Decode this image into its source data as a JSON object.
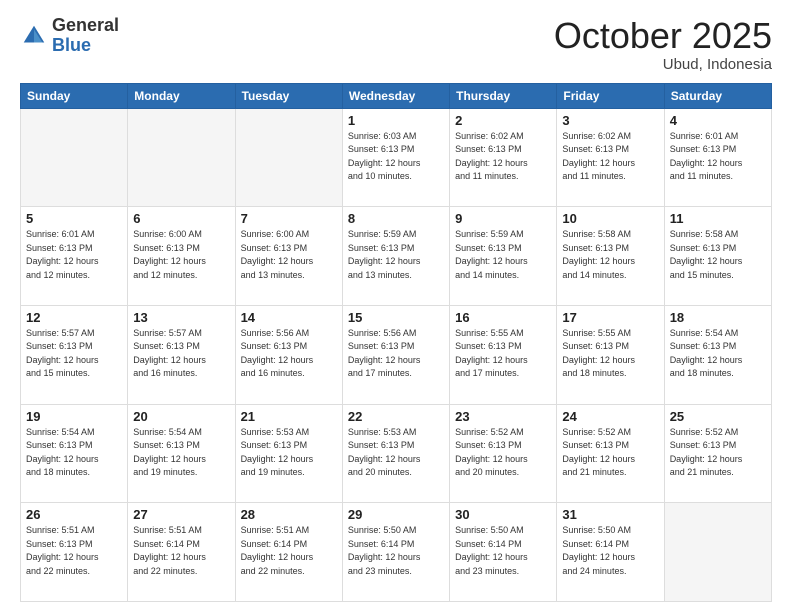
{
  "header": {
    "logo_general": "General",
    "logo_blue": "Blue",
    "month": "October 2025",
    "location": "Ubud, Indonesia"
  },
  "days_of_week": [
    "Sunday",
    "Monday",
    "Tuesday",
    "Wednesday",
    "Thursday",
    "Friday",
    "Saturday"
  ],
  "weeks": [
    {
      "days": [
        {
          "num": "",
          "info": ""
        },
        {
          "num": "",
          "info": ""
        },
        {
          "num": "",
          "info": ""
        },
        {
          "num": "1",
          "info": "Sunrise: 6:03 AM\nSunset: 6:13 PM\nDaylight: 12 hours\nand 10 minutes."
        },
        {
          "num": "2",
          "info": "Sunrise: 6:02 AM\nSunset: 6:13 PM\nDaylight: 12 hours\nand 11 minutes."
        },
        {
          "num": "3",
          "info": "Sunrise: 6:02 AM\nSunset: 6:13 PM\nDaylight: 12 hours\nand 11 minutes."
        },
        {
          "num": "4",
          "info": "Sunrise: 6:01 AM\nSunset: 6:13 PM\nDaylight: 12 hours\nand 11 minutes."
        }
      ]
    },
    {
      "days": [
        {
          "num": "5",
          "info": "Sunrise: 6:01 AM\nSunset: 6:13 PM\nDaylight: 12 hours\nand 12 minutes."
        },
        {
          "num": "6",
          "info": "Sunrise: 6:00 AM\nSunset: 6:13 PM\nDaylight: 12 hours\nand 12 minutes."
        },
        {
          "num": "7",
          "info": "Sunrise: 6:00 AM\nSunset: 6:13 PM\nDaylight: 12 hours\nand 13 minutes."
        },
        {
          "num": "8",
          "info": "Sunrise: 5:59 AM\nSunset: 6:13 PM\nDaylight: 12 hours\nand 13 minutes."
        },
        {
          "num": "9",
          "info": "Sunrise: 5:59 AM\nSunset: 6:13 PM\nDaylight: 12 hours\nand 14 minutes."
        },
        {
          "num": "10",
          "info": "Sunrise: 5:58 AM\nSunset: 6:13 PM\nDaylight: 12 hours\nand 14 minutes."
        },
        {
          "num": "11",
          "info": "Sunrise: 5:58 AM\nSunset: 6:13 PM\nDaylight: 12 hours\nand 15 minutes."
        }
      ]
    },
    {
      "days": [
        {
          "num": "12",
          "info": "Sunrise: 5:57 AM\nSunset: 6:13 PM\nDaylight: 12 hours\nand 15 minutes."
        },
        {
          "num": "13",
          "info": "Sunrise: 5:57 AM\nSunset: 6:13 PM\nDaylight: 12 hours\nand 16 minutes."
        },
        {
          "num": "14",
          "info": "Sunrise: 5:56 AM\nSunset: 6:13 PM\nDaylight: 12 hours\nand 16 minutes."
        },
        {
          "num": "15",
          "info": "Sunrise: 5:56 AM\nSunset: 6:13 PM\nDaylight: 12 hours\nand 17 minutes."
        },
        {
          "num": "16",
          "info": "Sunrise: 5:55 AM\nSunset: 6:13 PM\nDaylight: 12 hours\nand 17 minutes."
        },
        {
          "num": "17",
          "info": "Sunrise: 5:55 AM\nSunset: 6:13 PM\nDaylight: 12 hours\nand 18 minutes."
        },
        {
          "num": "18",
          "info": "Sunrise: 5:54 AM\nSunset: 6:13 PM\nDaylight: 12 hours\nand 18 minutes."
        }
      ]
    },
    {
      "days": [
        {
          "num": "19",
          "info": "Sunrise: 5:54 AM\nSunset: 6:13 PM\nDaylight: 12 hours\nand 18 minutes."
        },
        {
          "num": "20",
          "info": "Sunrise: 5:54 AM\nSunset: 6:13 PM\nDaylight: 12 hours\nand 19 minutes."
        },
        {
          "num": "21",
          "info": "Sunrise: 5:53 AM\nSunset: 6:13 PM\nDaylight: 12 hours\nand 19 minutes."
        },
        {
          "num": "22",
          "info": "Sunrise: 5:53 AM\nSunset: 6:13 PM\nDaylight: 12 hours\nand 20 minutes."
        },
        {
          "num": "23",
          "info": "Sunrise: 5:52 AM\nSunset: 6:13 PM\nDaylight: 12 hours\nand 20 minutes."
        },
        {
          "num": "24",
          "info": "Sunrise: 5:52 AM\nSunset: 6:13 PM\nDaylight: 12 hours\nand 21 minutes."
        },
        {
          "num": "25",
          "info": "Sunrise: 5:52 AM\nSunset: 6:13 PM\nDaylight: 12 hours\nand 21 minutes."
        }
      ]
    },
    {
      "days": [
        {
          "num": "26",
          "info": "Sunrise: 5:51 AM\nSunset: 6:13 PM\nDaylight: 12 hours\nand 22 minutes."
        },
        {
          "num": "27",
          "info": "Sunrise: 5:51 AM\nSunset: 6:14 PM\nDaylight: 12 hours\nand 22 minutes."
        },
        {
          "num": "28",
          "info": "Sunrise: 5:51 AM\nSunset: 6:14 PM\nDaylight: 12 hours\nand 22 minutes."
        },
        {
          "num": "29",
          "info": "Sunrise: 5:50 AM\nSunset: 6:14 PM\nDaylight: 12 hours\nand 23 minutes."
        },
        {
          "num": "30",
          "info": "Sunrise: 5:50 AM\nSunset: 6:14 PM\nDaylight: 12 hours\nand 23 minutes."
        },
        {
          "num": "31",
          "info": "Sunrise: 5:50 AM\nSunset: 6:14 PM\nDaylight: 12 hours\nand 24 minutes."
        },
        {
          "num": "",
          "info": ""
        }
      ]
    }
  ]
}
